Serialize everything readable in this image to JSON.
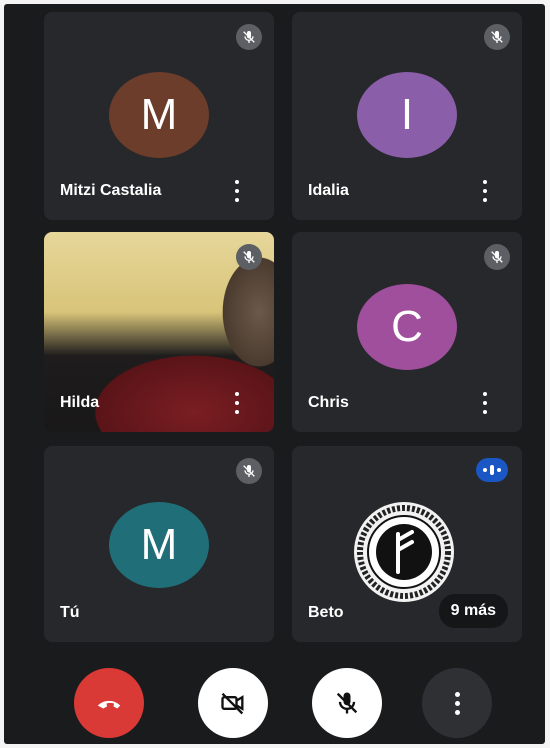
{
  "participants": [
    {
      "name": "Mitzi Castalia",
      "initial": "M",
      "avatar_color": "#6b3d2a"
    },
    {
      "name": "Idalia",
      "initial": "I",
      "avatar_color": "#8a5ea8"
    },
    {
      "name": "Hilda"
    },
    {
      "name": "Chris",
      "initial": "C",
      "avatar_color": "#a04f9d"
    },
    {
      "name": "Tú",
      "initial": "M",
      "avatar_color": "#1f6e78"
    },
    {
      "name": "Beto"
    }
  ],
  "more_participants_label": "9 más",
  "controls": {
    "end_call_icon": "phone-hangup-icon",
    "camera_icon": "video-off-icon",
    "mic_icon": "mic-off-icon",
    "more_icon": "more-vert-icon"
  },
  "colors": {
    "background": "#1a1b1d",
    "tile": "#26282b",
    "end_call": "#d93a36",
    "speaking_badge": "#1a56c4"
  }
}
